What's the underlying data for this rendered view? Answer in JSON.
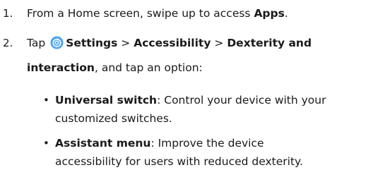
{
  "steps": [
    {
      "number": "1.",
      "text_before": "From a Home screen, swipe up to access ",
      "bold": "Apps",
      "text_after": "."
    },
    {
      "number": "2.",
      "tap_text": "Tap",
      "settings": "Settings",
      "sep1": ">",
      "accessibility": "Accessibility",
      "sep2": ">",
      "dexterity_line1": "Dexterity and",
      "dexterity_line2": "interaction",
      "tail": ", and tap an option:"
    }
  ],
  "options": [
    {
      "bullet": "•",
      "title": "Universal switch",
      "desc_line1": ": Control your device with your",
      "desc_line2": "customized switches."
    },
    {
      "bullet": "•",
      "title": "Assistant menu",
      "desc_line1": ": Improve the device",
      "desc_line2": "accessibility for users with reduced dexterity."
    }
  ],
  "icon": {
    "name": "settings-gear-icon",
    "color": "#4aa3f5"
  }
}
